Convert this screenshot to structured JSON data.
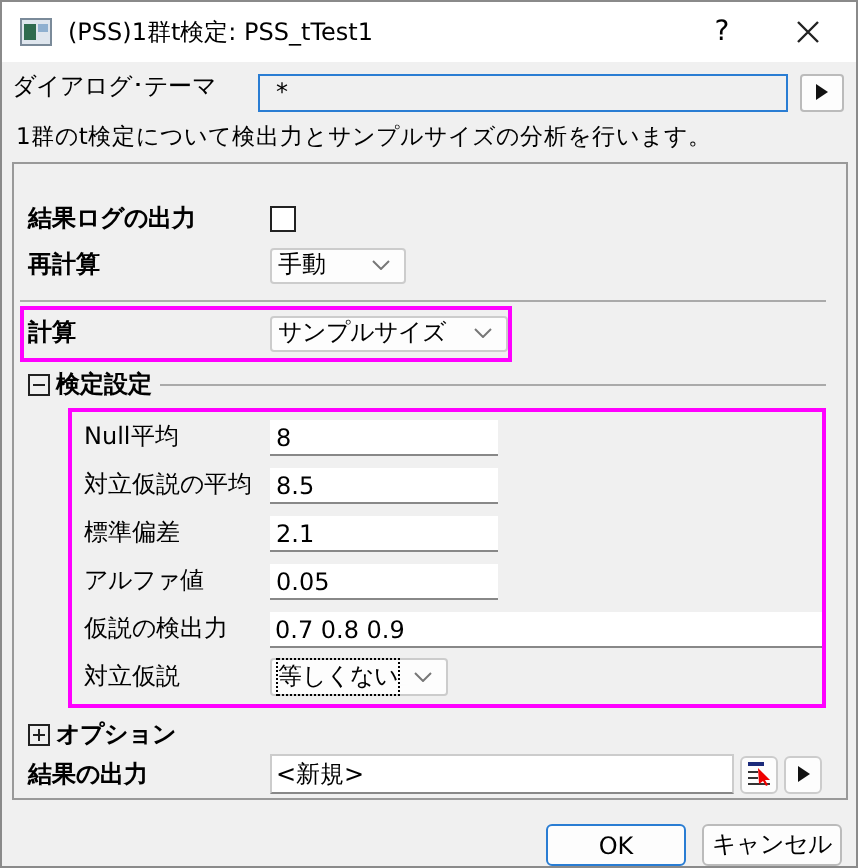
{
  "window": {
    "title": "(PSS)1群t検定: PSS_tTest1",
    "help": "?"
  },
  "theme": {
    "label": "ダイアログ･テーマ",
    "value": "*"
  },
  "description": "1群のt検定について検出力とサンプルサイズの分析を行います。",
  "settings": [
    {
      "kind": "checkbox",
      "label": "結果ログの出力",
      "checked": false
    },
    {
      "kind": "select",
      "label": "再計算",
      "value": "手動"
    },
    {
      "kind": "separator"
    },
    {
      "kind": "select",
      "label": "計算",
      "value": "サンプルサイズ",
      "highlighted": true
    },
    {
      "kind": "group",
      "label": "検定設定",
      "expanded": true,
      "highlighted": true,
      "children": [
        {
          "kind": "input",
          "label": "Null平均",
          "value": "8"
        },
        {
          "kind": "input",
          "label": "対立仮説の平均",
          "value": "8.5"
        },
        {
          "kind": "input",
          "label": "標準偏差",
          "value": "2.1"
        },
        {
          "kind": "input",
          "label": "アルファ値",
          "value": "0.05"
        },
        {
          "kind": "list_input",
          "label": "仮説の検出力",
          "value": "0.7 0.8 0.9"
        },
        {
          "kind": "select",
          "label": "対立仮説",
          "value": "等しくない",
          "focused": true
        }
      ]
    },
    {
      "kind": "group",
      "label": "オプション",
      "expanded": false
    },
    {
      "kind": "output",
      "label": "結果の出力",
      "value": "<新規>"
    }
  ],
  "buttons": [
    {
      "label": "OK",
      "default": true
    },
    {
      "label": "キャンセル",
      "default": false
    }
  ]
}
